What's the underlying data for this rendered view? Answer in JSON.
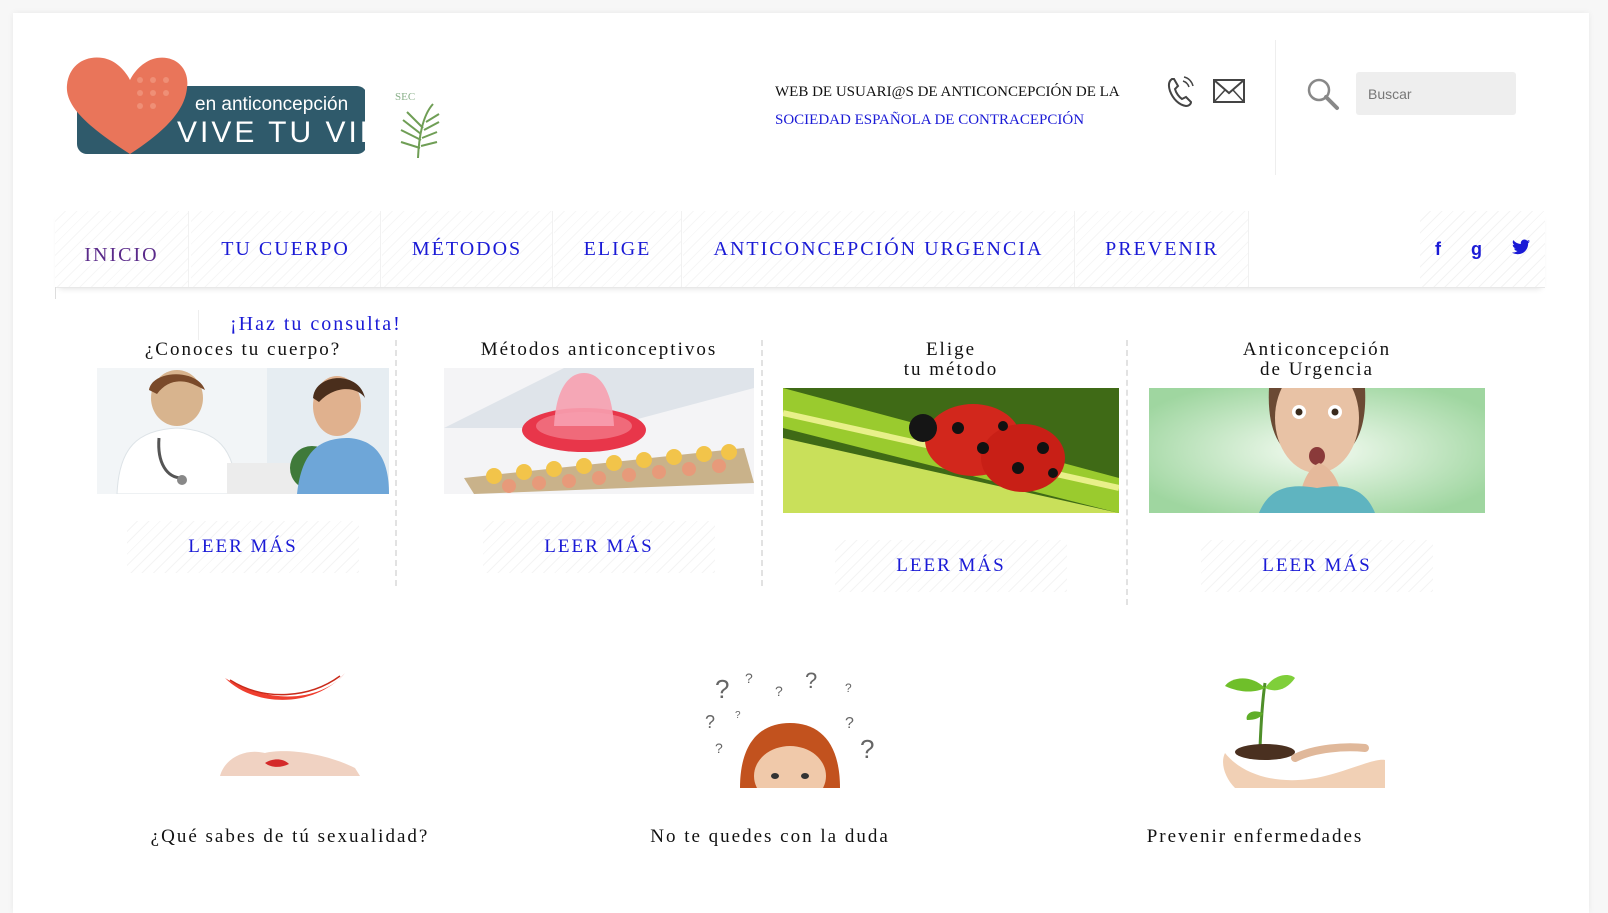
{
  "header": {
    "logo_small": "en anticoncepción",
    "logo_big": "VIVE TU VIDA",
    "sec_label": "SEC",
    "tagline": "WEB DE USUARI@S DE ANTICONCEPCIÓN DE LA",
    "tagline_link": "SOCIEDAD ESPAÑOLA DE CONTRACEPCIÓN",
    "search_placeholder": "Buscar"
  },
  "nav": {
    "items": [
      "Inicio",
      "Tu Cuerpo",
      "Métodos",
      "Elige",
      "Anticoncepción Urgencia",
      "Prevenir"
    ],
    "sub_item": "¡Haz tu consulta!",
    "social": [
      "f",
      "g",
      "t"
    ]
  },
  "cards": [
    {
      "title": "¿Conoces tu cuerpo?",
      "button": "LEER MÁS"
    },
    {
      "title": "Métodos anticonceptivos",
      "button": "LEER MÁS"
    },
    {
      "title": "Elige\ntu método",
      "button": "LEER MÁS"
    },
    {
      "title": "Anticoncepción\nde Urgencia",
      "button": "LEER MÁS"
    }
  ],
  "bottom": [
    {
      "title": "¿Qué sabes de tú sexualidad?"
    },
    {
      "title": "No te quedes con la duda"
    },
    {
      "title": "Prevenir enfermedades"
    }
  ],
  "colors": {
    "link": "#1a1ad6",
    "active": "#5a2a8a",
    "logo_teal": "#2f5a6b",
    "logo_heart": "#e9755a"
  }
}
